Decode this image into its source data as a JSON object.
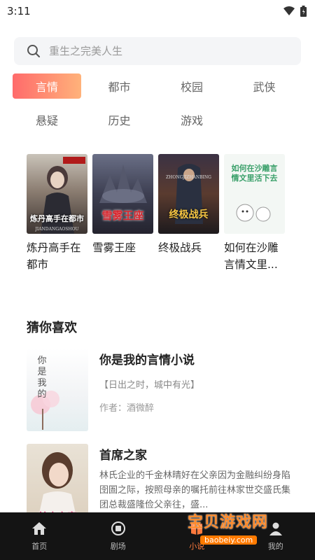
{
  "status": {
    "time": "3:11"
  },
  "search": {
    "placeholder": "重生之完美人生"
  },
  "categories": [
    {
      "label": "言情",
      "active": true
    },
    {
      "label": "都市"
    },
    {
      "label": "校园"
    },
    {
      "label": "武侠"
    },
    {
      "label": "悬疑"
    },
    {
      "label": "历史"
    },
    {
      "label": "游戏"
    }
  ],
  "books": [
    {
      "title_line1": "炼丹高手在",
      "title_line2": "都市",
      "cover_text": "炼丹高手在都市",
      "cover_sub": "JIANDANGAOSHOU"
    },
    {
      "title_line1": "雪雾王座",
      "title_line2": "",
      "cover_text": "雪雾王座"
    },
    {
      "title_line1": "终极战兵",
      "title_line2": "",
      "cover_text": "终极战兵",
      "cover_sub": "ZHONGJIZHANBING"
    },
    {
      "title_line1": "如何在沙雕",
      "title_line2": "言情文里...",
      "cover_text": "如何在沙雕言情文里活下去"
    }
  ],
  "section": {
    "title": "猜你喜欢"
  },
  "recommendations": [
    {
      "title": "你是我的言情小说",
      "tag": "【日出之时，城中有光】",
      "author": "作者：酒微醉",
      "cover_text": "你是我的"
    },
    {
      "title": "首席之家",
      "desc": "林氏企业的千金林晴好在父亲因为金融纠纷身陷囹圄之际，按照母亲的嘱托前往林家世交盛氏集团总裁盛隆俭父亲往，盛...",
      "cover_text": "首席之家"
    }
  ],
  "tabs": [
    {
      "label": "首页",
      "icon": "home-icon"
    },
    {
      "label": "剧场",
      "icon": "theater-icon"
    },
    {
      "label": "小说",
      "icon": "book-icon",
      "active": true
    },
    {
      "label": "我的",
      "icon": "profile-icon"
    }
  ],
  "watermark": {
    "main": "宝贝游戏网",
    "sub": "baobeiy.com"
  },
  "colors": {
    "accent": "#ff7a3d",
    "tabbar": "#141414",
    "search_bg": "#f4f5f7"
  }
}
